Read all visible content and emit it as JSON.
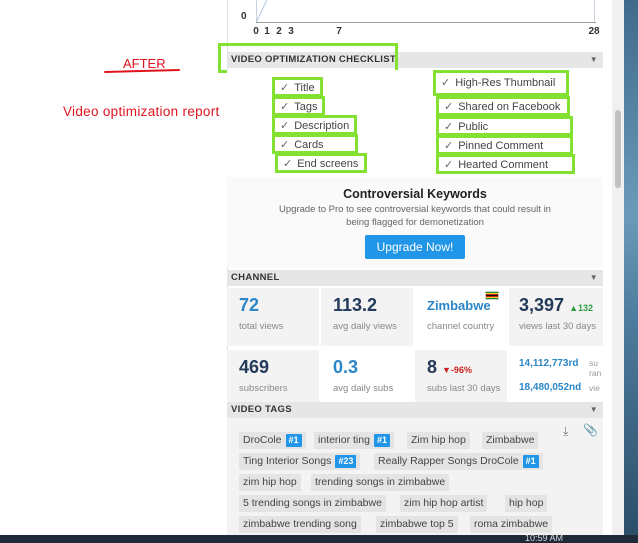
{
  "annotation": {
    "after": "AFTER",
    "report": "Video optimization  report"
  },
  "chart": {
    "y_label": "0",
    "x_ticks": [
      "0",
      "1",
      "2",
      "3",
      "7",
      "28"
    ]
  },
  "optimization": {
    "header": "VIDEO OPTIMIZATION CHECKLIST",
    "left_items": [
      "Title",
      "Tags",
      "Description",
      "Cards",
      "End screens"
    ],
    "right_items": [
      "High-Res Thumbnail",
      "Shared on Facebook",
      "Public",
      "Pinned Comment",
      "Hearted Comment"
    ],
    "check_glyph": "✓"
  },
  "promo": {
    "title": "Controversial Keywords",
    "text": "Upgrade to Pro to see controversial keywords that could result in being flagged for demonetization",
    "button": "Upgrade Now!"
  },
  "channel": {
    "header": "CHANNEL",
    "stats": [
      {
        "value": "72",
        "label": "total views"
      },
      {
        "value": "113.2",
        "label": "avg daily views"
      },
      {
        "value": "Zimbabwe",
        "label": "channel country"
      },
      {
        "value": "3,397",
        "change": "▲132",
        "label": "views last 30 days"
      },
      {
        "value": "469",
        "label": "subscribers"
      },
      {
        "value": "0.3",
        "label": "avg daily subs"
      },
      {
        "value": "8",
        "change": "▼-96%",
        "label": "subs last 30 days"
      },
      {
        "value": "14,112,773rd",
        "label": "su"
      },
      {
        "value": "18,480,052nd",
        "label": "vie"
      }
    ],
    "rank_label_top": "ran"
  },
  "tags": {
    "header": "VIDEO TAGS",
    "items": [
      {
        "text": "DroCole",
        "rank": "#1"
      },
      {
        "text": "interior ting",
        "rank": "#1"
      },
      {
        "text": "Zim hip hop"
      },
      {
        "text": "Zimbabwe"
      },
      {
        "text": "Ting Interior Songs",
        "rank": "#23"
      },
      {
        "text": "Really Rapper Songs DroCole",
        "rank": "#1"
      },
      {
        "text": "zim hip hop"
      },
      {
        "text": "trending songs in zimbabwe"
      },
      {
        "text": "5 trending songs in zimbabwe"
      },
      {
        "text": "zim hip hop artist"
      },
      {
        "text": "hip hop"
      },
      {
        "text": "zimbabwe trending song"
      },
      {
        "text": "zimbabwe top 5"
      },
      {
        "text": "roma zimbabwe"
      }
    ]
  },
  "taskbar": {
    "clock": "10:59 AM"
  },
  "colors": {
    "highlight": "#84e132",
    "annotation": "#e0141e",
    "accent": "#2196e9"
  }
}
